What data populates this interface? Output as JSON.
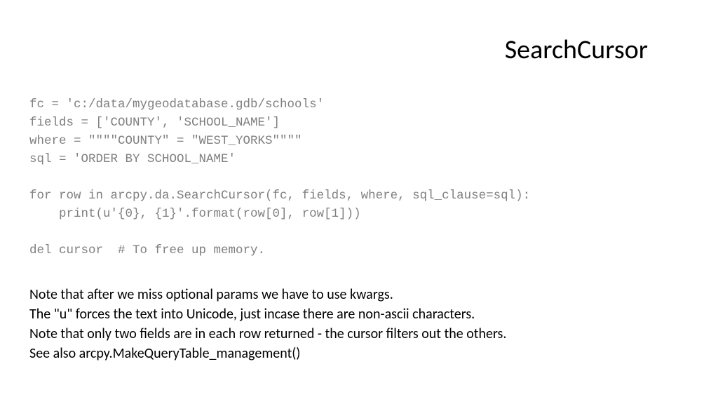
{
  "title": "SearchCursor",
  "code": "fc = 'c:/data/mygeodatabase.gdb/schools'\nfields = ['COUNTY', 'SCHOOL_NAME']\nwhere = \"\"\"\"COUNTY\" = \"WEST_YORKS\"\"\"\"\nsql = 'ORDER BY SCHOOL_NAME'\n\nfor row in arcpy.da.SearchCursor(fc, fields, where, sql_clause=sql):\n    print(u'{0}, {1}'.format(row[0], row[1]))\n\ndel cursor  # To free up memory.",
  "notes": {
    "line1": "Note that after we miss optional params we have to use kwargs.",
    "line2": "The \"u\" forces the text into Unicode, just incase there are non-ascii characters.",
    "line3": "Note that only two fields are in each row returned - the cursor filters out the others.",
    "line4": "See also arcpy.MakeQueryTable_management()"
  }
}
